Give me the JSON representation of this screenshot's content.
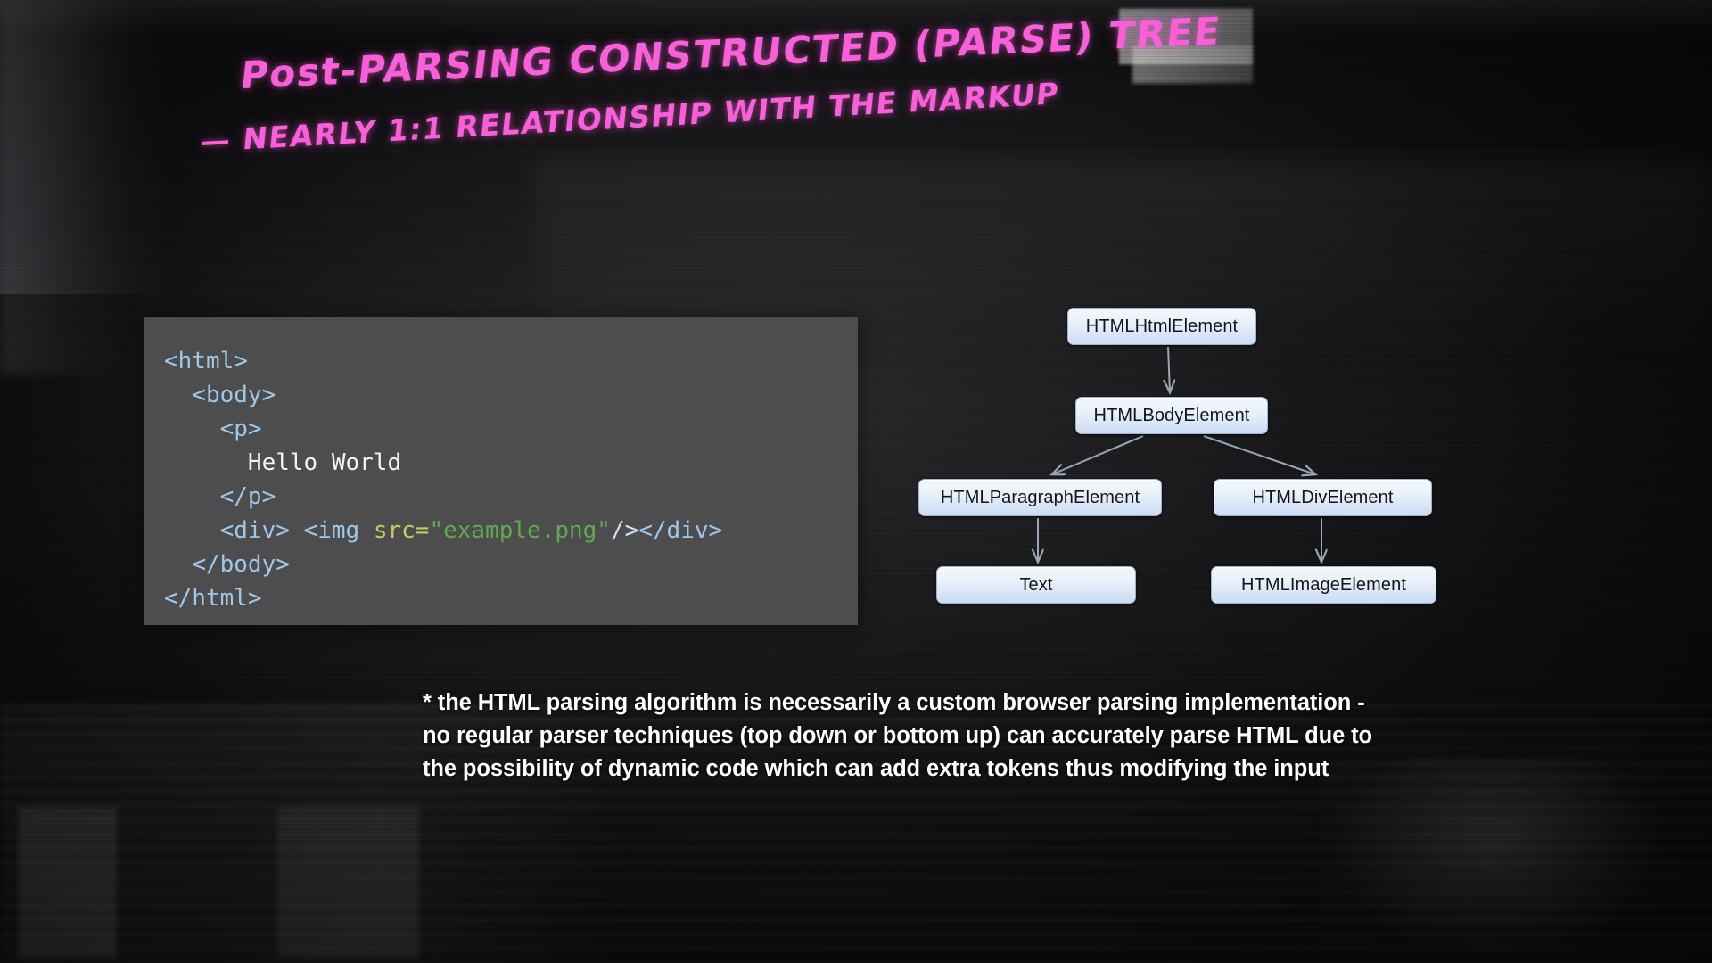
{
  "slide": {
    "handwriting": {
      "line1": "Post-PARSING  CONSTRUCTED (PARSE) TREE",
      "line2": "— NEARLY  1:1 RELATIONSHIP WITH  THE  MARKUP",
      "ink_color": "#f85fd8"
    },
    "code_block": {
      "background_color": "#4d4d4d",
      "tag_color": "#9ec8ea",
      "attr_color": "#c8c864",
      "string_color": "#5fa84f",
      "text_color": "#ffffff",
      "lines": [
        {
          "indent": 0,
          "tokens": [
            {
              "type": "tag",
              "text": "<html>"
            }
          ]
        },
        {
          "indent": 1,
          "tokens": [
            {
              "type": "tag",
              "text": "<body>"
            }
          ]
        },
        {
          "indent": 2,
          "tokens": [
            {
              "type": "tag",
              "text": "<p>"
            }
          ]
        },
        {
          "indent": 3,
          "tokens": [
            {
              "type": "text",
              "text": "Hello World"
            }
          ]
        },
        {
          "indent": 2,
          "tokens": [
            {
              "type": "tag",
              "text": "</p>"
            }
          ]
        },
        {
          "indent": 2,
          "tokens": [
            {
              "type": "tag",
              "text": "<div> <img "
            },
            {
              "type": "attr",
              "text": "src="
            },
            {
              "type": "string",
              "text": "\"example.png\""
            },
            {
              "type": "punct",
              "text": "/>"
            },
            {
              "type": "tag",
              "text": "</div>"
            }
          ]
        },
        {
          "indent": 1,
          "tokens": [
            {
              "type": "tag",
              "text": "</body>"
            }
          ]
        },
        {
          "indent": 0,
          "tokens": [
            {
              "type": "tag",
              "text": "</html>"
            }
          ]
        }
      ]
    },
    "tree": {
      "node_fill_top": "#f4f8fd",
      "node_fill_bottom": "#ccdcf4",
      "arrow_color": "#9aa6b4",
      "nodes": [
        {
          "id": "html",
          "label": "HTMLHtmlElement"
        },
        {
          "id": "body",
          "label": "HTMLBodyElement"
        },
        {
          "id": "paragraph",
          "label": "HTMLParagraphElement"
        },
        {
          "id": "div",
          "label": "HTMLDivElement"
        },
        {
          "id": "text",
          "label": "Text"
        },
        {
          "id": "image",
          "label": "HTMLImageElement"
        }
      ],
      "edges": [
        {
          "from": "html",
          "to": "body"
        },
        {
          "from": "body",
          "to": "paragraph"
        },
        {
          "from": "body",
          "to": "div"
        },
        {
          "from": "paragraph",
          "to": "text"
        },
        {
          "from": "div",
          "to": "image"
        }
      ]
    },
    "footnote": {
      "line1": "* the HTML parsing algorithm is necessarily a custom browser parsing implementation -",
      "line2": "no regular parser techniques (top down or bottom up) can accurately parse HTML due to",
      "line3": "the possibility of dynamic code which can add extra tokens thus modifying the input"
    }
  }
}
